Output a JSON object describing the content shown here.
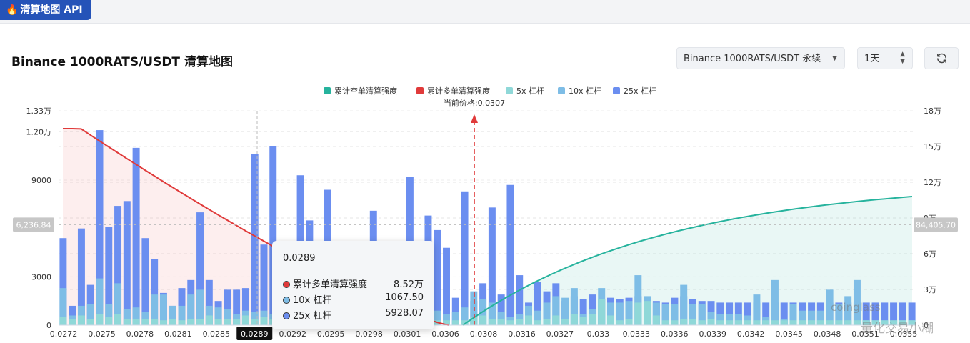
{
  "app": {
    "badge": "清算地图 API",
    "flame_icon": "flame-icon"
  },
  "page": {
    "title": "Binance 1000RATS/USDT 清算地图"
  },
  "controls": {
    "market_select": "Binance 1000RATS/USDT 永续",
    "range_select": "1天",
    "refresh_icon": "refresh-icon"
  },
  "chart_data": {
    "type": "bar",
    "legend": [
      {
        "name": "累计空单清算强度",
        "color": "#26b39d"
      },
      {
        "name": "累计多单清算强度",
        "color": "#e03a3a"
      },
      {
        "name": "5x 杠杆",
        "color": "#8fd8d8"
      },
      {
        "name": "10x 杠杆",
        "color": "#7ebde6"
      },
      {
        "name": "25x 杠杆",
        "color": "#6b8ef0"
      }
    ],
    "current_price_label": "当前价格:0.0307",
    "current_price": 0.0307,
    "x_ticks": [
      "0.0272",
      "0.0275",
      "0.0278",
      "0.0281",
      "0.0285",
      "0.0289",
      "0.0292",
      "0.0295",
      "0.0298",
      "0.0301",
      "0.0306",
      "0.0308",
      "0.0316",
      "0.0327",
      "0.033",
      "0.0333",
      "0.0336",
      "0.0339",
      "0.0342",
      "0.0345",
      "0.0348",
      "0.0351",
      "0.0355"
    ],
    "x_highlight": "0.0289",
    "y_left_ticks": [
      "0",
      "3000",
      "9000",
      "1.20万",
      "1.33万"
    ],
    "y_left_values": [
      0,
      3000,
      9000,
      12000,
      13300
    ],
    "y_left_range": [
      0,
      13300
    ],
    "y_right_ticks": [
      "0",
      "3万",
      "6万",
      "9万",
      "12万",
      "15万",
      "18万"
    ],
    "y_right_range": [
      0,
      180000
    ],
    "y_left_marker": "6,236.84",
    "y_left_marker_value": 6236.84,
    "y_right_marker": "84,405.70",
    "y_right_marker_value": 84405.7,
    "bars": {
      "lev5": [
        500,
        400,
        600,
        400,
        700,
        500,
        700,
        400,
        400,
        400,
        400,
        300,
        400,
        300,
        400,
        400,
        600,
        400,
        400,
        400,
        600,
        400,
        500,
        400,
        400,
        500,
        400,
        400,
        400,
        400,
        500,
        500,
        400,
        400,
        400,
        400,
        300,
        300,
        300,
        300,
        300,
        300,
        300,
        300,
        300,
        500,
        600,
        400,
        400,
        300,
        400,
        600,
        300,
        400,
        600,
        400,
        700,
        500,
        700,
        1600,
        600,
        300,
        400,
        1400,
        1500,
        600,
        300,
        300,
        400,
        400,
        300,
        400,
        300,
        300,
        300,
        300,
        300,
        300,
        300,
        300,
        300,
        300,
        300,
        300,
        300,
        300,
        300,
        300,
        300,
        300,
        300,
        300,
        300,
        300
      ],
      "lev10": [
        2300,
        600,
        1200,
        1300,
        2900,
        1300,
        2600,
        1000,
        1100,
        800,
        1900,
        1900,
        1200,
        1200,
        1900,
        2200,
        1200,
        1100,
        1000,
        700,
        900,
        800,
        900,
        700,
        800,
        700,
        900,
        700,
        800,
        700,
        900,
        900,
        700,
        600,
        600,
        600,
        500,
        500,
        500,
        500,
        700,
        900,
        700,
        800,
        1100,
        2100,
        1600,
        1400,
        800,
        500,
        700,
        1200,
        900,
        1400,
        1800,
        1700,
        2300,
        700,
        1000,
        2300,
        1400,
        1400,
        1500,
        3100,
        1800,
        1400,
        1300,
        1300,
        2500,
        1300,
        1300,
        800,
        700,
        700,
        700,
        600,
        1900,
        500,
        2800,
        400,
        1300,
        900,
        900,
        900,
        2200,
        1300,
        1800,
        2800,
        300,
        300,
        300,
        300,
        300,
        300
      ],
      "lev25": [
        5400,
        1200,
        6000,
        2500,
        12100,
        6100,
        7400,
        7700,
        11000,
        5400,
        4100,
        2000,
        1200,
        2300,
        2800,
        7000,
        2800,
        1500,
        2200,
        2200,
        2300,
        10600,
        5000,
        11100,
        4100,
        1800,
        9300,
        6500,
        4100,
        8400,
        1600,
        1600,
        2600,
        4700,
        7100,
        5100,
        2100,
        1500,
        9200,
        3600,
        6800,
        5900,
        4800,
        1700,
        8300,
        1500,
        2600,
        7300,
        1900,
        8700,
        3100,
        1400,
        2700,
        2100,
        2600,
        1500,
        1800,
        1600,
        1900,
        1600,
        1700,
        1600,
        1700,
        1800,
        1600,
        1500,
        1400,
        1700,
        1800,
        1600,
        1500,
        1500,
        1400,
        1400,
        1400,
        1400,
        1400,
        1400,
        1400,
        1400,
        1400,
        1400,
        1400,
        1400,
        1400,
        1400,
        1400,
        1400,
        1400,
        1400,
        1400,
        1400,
        1400,
        1400
      ]
    },
    "hovered": {
      "price": "0.0289"
    },
    "tooltip": {
      "title": "0.0289",
      "rows": [
        {
          "label": "累计多单清算强度",
          "value": "8.52万",
          "color": "#e03a3a"
        },
        {
          "label": "10x 杠杆",
          "value": "1067.50",
          "color": "#7ebde6"
        },
        {
          "label": "25x 杠杆",
          "value": "5928.07",
          "color": "#6b8ef0"
        }
      ]
    }
  },
  "watermark": {
    "left_text": "coinglass",
    "right_text": "量化交易小糊"
  }
}
